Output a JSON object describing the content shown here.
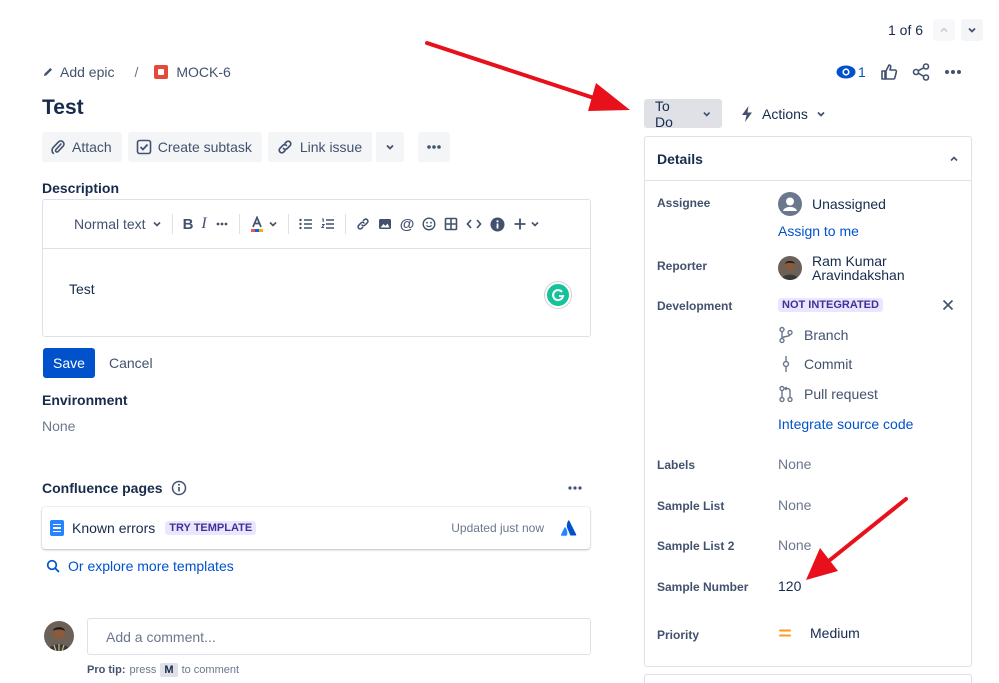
{
  "pager": {
    "text": "1 of 6"
  },
  "breadcrumb": {
    "epic": "Add epic",
    "separator": "/",
    "issue_key": "MOCK-6"
  },
  "header": {
    "watch_count": "1"
  },
  "issue": {
    "title": "Test"
  },
  "toolbar": {
    "attach": "Attach",
    "create_subtask": "Create subtask",
    "link_issue": "Link issue"
  },
  "description": {
    "label": "Description",
    "text_style": "Normal text",
    "content": "Test"
  },
  "editor_actions": {
    "save": "Save",
    "cancel": "Cancel"
  },
  "environment": {
    "label": "Environment",
    "value": "None"
  },
  "confluence": {
    "label": "Confluence pages",
    "card_title": "Known errors",
    "card_badge": "TRY TEMPLATE",
    "card_updated": "Updated just now",
    "explore": "Or explore more templates"
  },
  "comment": {
    "placeholder": "Add a comment...",
    "protip_prefix": "Pro tip:",
    "protip_press": "press",
    "protip_key": "M",
    "protip_suffix": "to comment"
  },
  "status": {
    "label": "To Do"
  },
  "actions": {
    "label": "Actions"
  },
  "details": {
    "title": "Details",
    "assignee": {
      "label": "Assignee",
      "value": "Unassigned",
      "assign_link": "Assign to me"
    },
    "reporter": {
      "label": "Reporter",
      "name_line1": "Ram Kumar",
      "name_line2": "Aravindakshan"
    },
    "development": {
      "label": "Development",
      "badge": "NOT INTEGRATED",
      "items": [
        "Branch",
        "Commit",
        "Pull request"
      ],
      "integrate_link": "Integrate source code"
    },
    "labels": {
      "label": "Labels",
      "value": "None"
    },
    "sample_list": {
      "label": "Sample List",
      "value": "None"
    },
    "sample_list_2": {
      "label": "Sample List 2",
      "value": "None"
    },
    "sample_number": {
      "label": "Sample Number",
      "value": "120"
    },
    "priority": {
      "label": "Priority",
      "value": "Medium"
    }
  },
  "colors": {
    "primary": "#0052cc",
    "text": "#172b4d",
    "subtle": "#42526e",
    "muted": "#6b778c",
    "annotation_arrow": "#e8101a",
    "priority_medium": "#ff991f"
  }
}
